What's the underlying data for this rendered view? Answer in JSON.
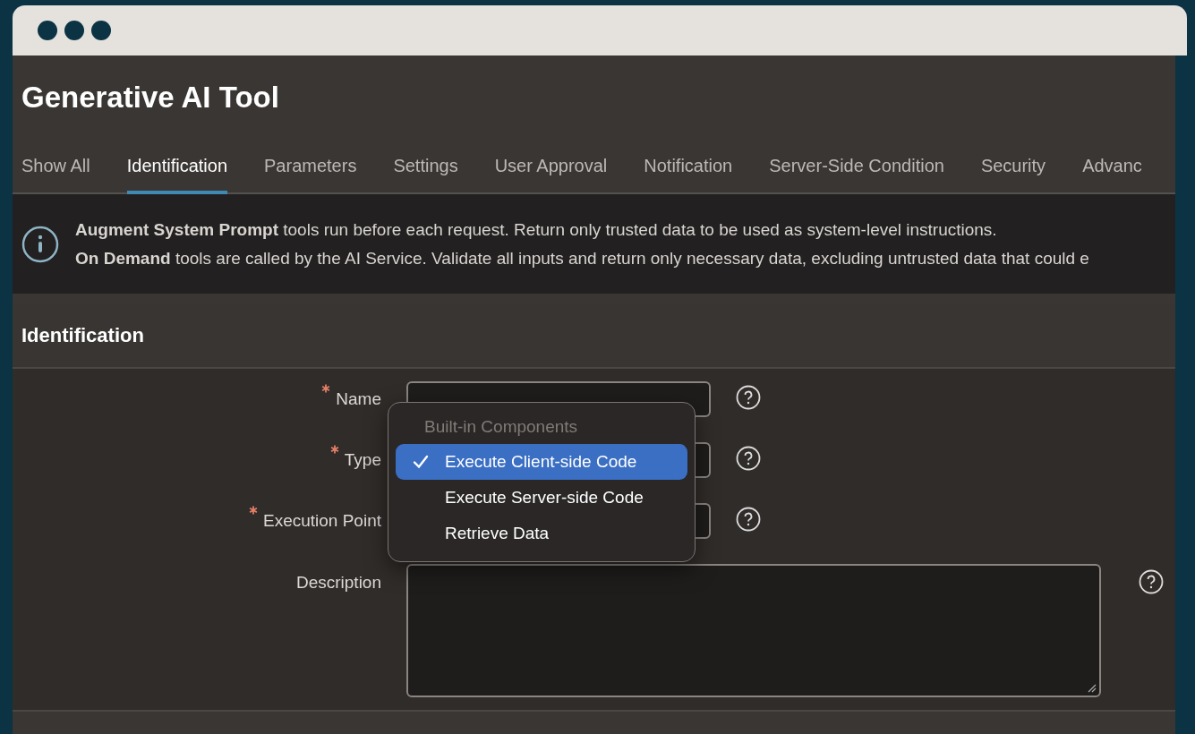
{
  "window": {
    "title": "Generative AI Tool"
  },
  "tabs": [
    {
      "label": "Show All",
      "selected": false
    },
    {
      "label": "Identification",
      "selected": true
    },
    {
      "label": "Parameters",
      "selected": false
    },
    {
      "label": "Settings",
      "selected": false
    },
    {
      "label": "User Approval",
      "selected": false
    },
    {
      "label": "Notification",
      "selected": false
    },
    {
      "label": "Server-Side Condition",
      "selected": false
    },
    {
      "label": "Security",
      "selected": false
    },
    {
      "label": "Advanc",
      "selected": false
    }
  ],
  "banner": {
    "lines": [
      "**Augment System Prompt** tools run before each request. Return only trusted data to be used as system-level instructions.",
      "**On Demand** tools are called by the AI Service. Validate all inputs and return only necessary data, excluding untrusted data that could e"
    ]
  },
  "section": {
    "title": "Identification"
  },
  "fields": [
    {
      "label": "Name",
      "required": true,
      "kind": "text"
    },
    {
      "label": "Type",
      "required": true,
      "kind": "select"
    },
    {
      "label": "Execution Point",
      "required": true,
      "kind": "select"
    },
    {
      "label": "Description",
      "required": false,
      "kind": "textarea"
    }
  ],
  "dropdown": {
    "group": "Built-in Components",
    "options": [
      {
        "label": "Execute Client-side Code",
        "selected": true
      },
      {
        "label": "Execute Server-side Code",
        "selected": false
      },
      {
        "label": "Retrieve Data",
        "selected": false
      }
    ]
  }
}
